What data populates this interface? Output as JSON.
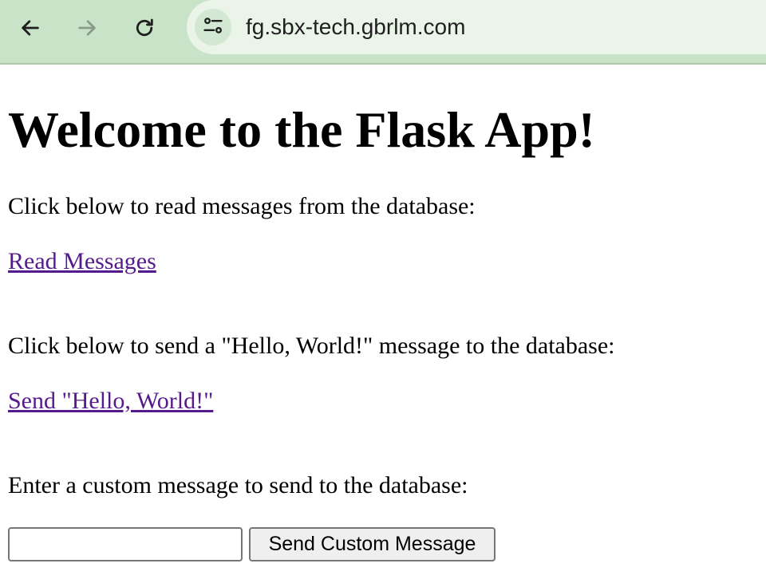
{
  "browser": {
    "url": "fg.sbx-tech.gbrlm.com",
    "icons": {
      "back": "arrow-left-icon",
      "forward": "arrow-right-icon",
      "reload": "reload-icon",
      "site_info": "tune-icon"
    }
  },
  "page": {
    "heading": "Welcome to the Flask App!",
    "read_prompt": "Click below to read messages from the database:",
    "read_link": "Read Messages",
    "send_prompt": "Click below to send a \"Hello, World!\" message to the database:",
    "send_link": "Send \"Hello, World!\"",
    "custom_prompt": "Enter a custom message to send to the database:",
    "custom_input_value": "",
    "custom_button": "Send Custom Message"
  },
  "colors": {
    "toolbar_bg": "#c9e3c8",
    "omnibox_bg": "#eaf4e9",
    "visited_link": "#551a8b"
  }
}
